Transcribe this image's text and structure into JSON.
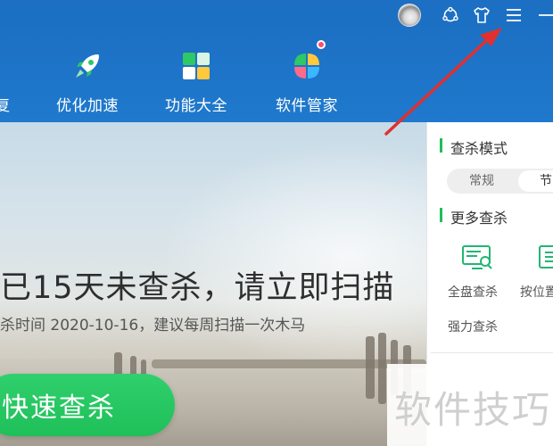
{
  "header": {
    "nav": [
      {
        "key": "repair",
        "label": "复"
      },
      {
        "key": "optimize",
        "label": "优化加速"
      },
      {
        "key": "features",
        "label": "功能大全"
      },
      {
        "key": "software",
        "label": "软件管家"
      }
    ],
    "icons": [
      "avatar",
      "skin-switch-icon",
      "shirt-icon",
      "menu-icon",
      "minimize-icon"
    ],
    "accent": "#1d72c6"
  },
  "hero": {
    "headline": "已15天未查杀，请立即扫描",
    "subline": "杀时间 2020-10-16，建议每周扫描一次木马",
    "quick_scan_label": "快速查杀",
    "button_color": "#22c35e"
  },
  "side_panel": {
    "mode_title": "查杀模式",
    "mode_options": {
      "normal": "常规",
      "save": "节"
    },
    "more_title": "更多查杀",
    "items": [
      {
        "label": "全盘查杀",
        "icon": "monitor-scan-icon"
      },
      {
        "label": "按位置",
        "icon": "list-scan-icon"
      },
      {
        "label": "强力查杀",
        "icon": ""
      }
    ],
    "accent": "#1fbf59"
  },
  "watermark": {
    "text": "软件技巧"
  },
  "annotation": {
    "type": "red-arrow",
    "points_to": "menu-icon",
    "color": "#e03030"
  }
}
